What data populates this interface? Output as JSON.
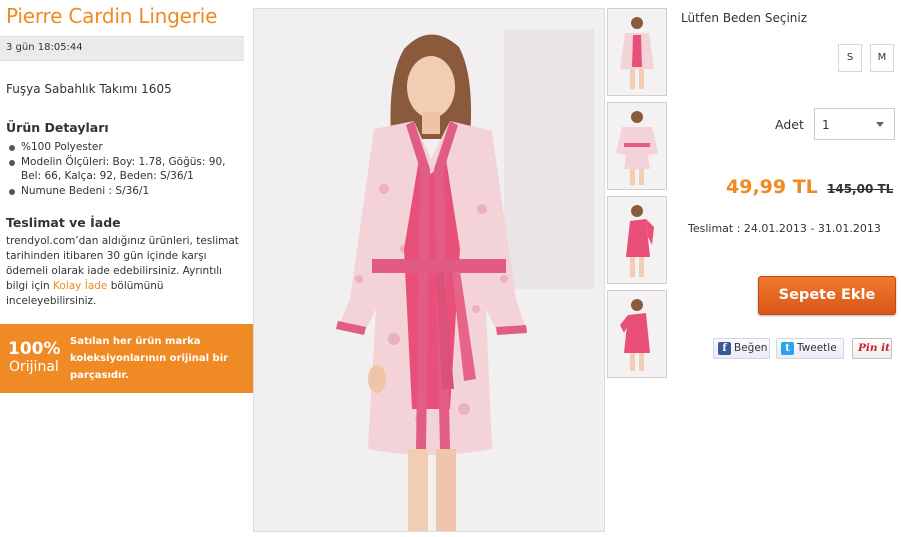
{
  "brand": "Pierre Cardin Lingerie",
  "timer": "3 gün 18:05:44",
  "product_name": "Fuşya Sabahlık Takımı 1605",
  "details": {
    "title": "Ürün Detayları",
    "items": [
      "%100 Polyester",
      "Modelin Ölçüleri: Boy: 1.78, Göğüs: 90, Bel: 66, Kalça: 92, Beden: S/36/1",
      "Numune Bedeni : S/36/1"
    ]
  },
  "returns": {
    "title": "Teslimat ve İade",
    "text_before": "trendyol.com’dan aldığınız ürünleri, teslimat tarihinden itibaren 30 gün içinde karşı ödemeli olarak iade edebilirsiniz. Ayrıntılı bilgi için ",
    "link": "Kolay İade",
    "text_after": " bölümünü inceleyebilirsiniz."
  },
  "original_badge": {
    "percent": "100%",
    "word": "Orijinal",
    "text": "Satılan her ürün marka koleksiyonlarının orijinal bir parçasıdır."
  },
  "sizes": {
    "title": "Lütfen Beden Seçiniz",
    "options": [
      "S",
      "M"
    ]
  },
  "quantity": {
    "label": "Adet",
    "value": "1"
  },
  "price": "49,99 TL",
  "old_price": "145,00 TL",
  "delivery": "Teslimat : 24.01.2013 - 31.01.2013",
  "add_to_cart": "Sepete Ekle",
  "social": {
    "facebook": "Beğen",
    "twitter": "Tweetle",
    "pinterest": "Pin it"
  },
  "colors": {
    "accent": "#f08a24",
    "robe": "#f3d3d8",
    "satin": "#e8507a"
  }
}
